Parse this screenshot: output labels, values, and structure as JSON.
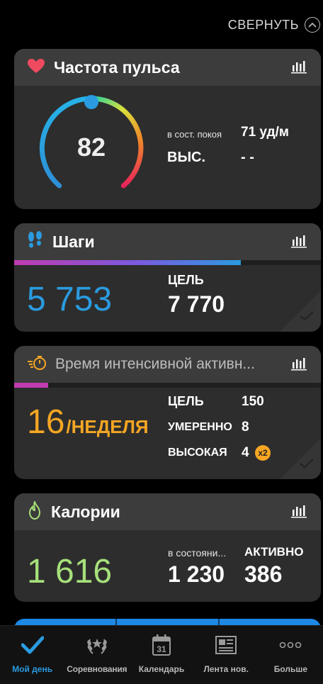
{
  "header": {
    "collapse_label": "СВЕРНУТЬ",
    "collapse_icon": "chevron-up-circle-icon"
  },
  "heart_rate": {
    "title": "Частота пульса",
    "icon": "heart-icon",
    "current": "82",
    "rest_label": "в сост. покоя",
    "rest_value": "71 уд/м",
    "high_label": "ВЫС.",
    "high_value": "- -",
    "colors": {
      "heart": "#ef4a5f"
    }
  },
  "steps": {
    "title": "Шаги",
    "icon": "footprints-icon",
    "value": "5 753",
    "goal_label": "ЦЕЛЬ",
    "goal_value": "7 770",
    "progress": 0.74,
    "colors": {
      "value": "#2a9be0",
      "icon": "#2a9be0"
    }
  },
  "intensity": {
    "title": "Время интенсивной активн...",
    "icon": "stopwatch-icon",
    "value": "16",
    "unit": "/НЕДЕЛЯ",
    "goal_label": "ЦЕЛЬ",
    "goal_value": "150",
    "moderate_label": "УМЕРЕННО",
    "moderate_value": "8",
    "high_label": "ВЫСОКАЯ",
    "high_value": "4",
    "multiplier_badge": "x2",
    "progress": 0.11,
    "colors": {
      "value": "#f5a623",
      "progress": "#c03cb0"
    }
  },
  "calories": {
    "title": "Калории",
    "icon": "flame-icon",
    "value": "1 616",
    "rest_label": "в состояни...",
    "rest_value": "1 230",
    "active_label": "АКТИВНО",
    "active_value": "386",
    "colors": {
      "value": "#a6e07a",
      "icon": "#a6e07a"
    }
  },
  "tabs": [
    {
      "label": "Мой день",
      "icon": "checkmark-icon",
      "active": true
    },
    {
      "label": "Соревнования",
      "icon": "laurel-wreath-icon",
      "active": false
    },
    {
      "label": "Календарь",
      "icon": "calendar-icon",
      "icon_text": "31",
      "active": false
    },
    {
      "label": "Лента нов.",
      "icon": "newsfeed-icon",
      "active": false
    },
    {
      "label": "Больше",
      "icon": "more-icon",
      "active": false
    }
  ]
}
